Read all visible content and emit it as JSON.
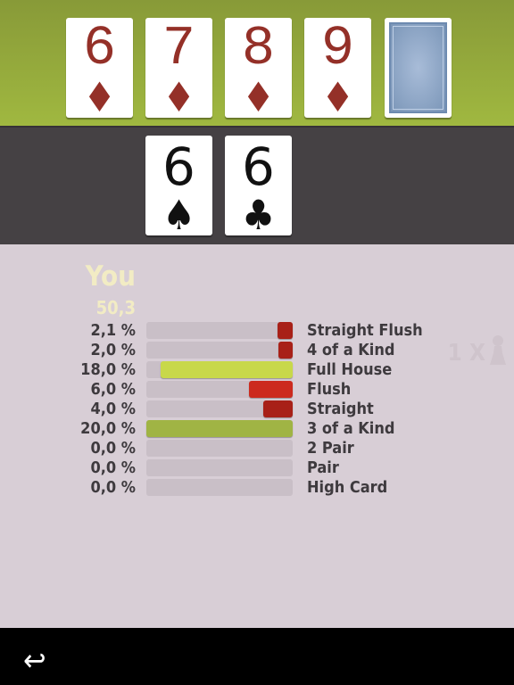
{
  "board": {
    "cards": [
      {
        "rank": "6",
        "suit": "♦"
      },
      {
        "rank": "7",
        "suit": "♦"
      },
      {
        "rank": "8",
        "suit": "♦"
      },
      {
        "rank": "9",
        "suit": "♦"
      }
    ]
  },
  "player": {
    "name": "You",
    "score": "50,3",
    "cards": [
      {
        "rank": "6",
        "suit": "♠"
      },
      {
        "rank": "6",
        "suit": "♣"
      }
    ]
  },
  "opponents": {
    "count_label": "1 X",
    "icon": "pawn-icon"
  },
  "odds": [
    {
      "pct": "2,1 %",
      "value": 2.1,
      "label": "Straight Flush",
      "color": "#a82018"
    },
    {
      "pct": "2,0 %",
      "value": 2.0,
      "label": "4 of a Kind",
      "color": "#a82018"
    },
    {
      "pct": "18,0 %",
      "value": 18.0,
      "label": "Full House",
      "color": "#c8d84a"
    },
    {
      "pct": "6,0 %",
      "value": 6.0,
      "label": "Flush",
      "color": "#cc2a1e"
    },
    {
      "pct": "4,0 %",
      "value": 4.0,
      "label": "Straight",
      "color": "#a82018"
    },
    {
      "pct": "20,0 %",
      "value": 20.0,
      "label": "3 of a Kind",
      "color": "#a0b444"
    },
    {
      "pct": "0,0 %",
      "value": 0,
      "label": "2 Pair",
      "color": "#a0b444"
    },
    {
      "pct": "0,0 %",
      "value": 0,
      "label": "Pair",
      "color": "#a0b444"
    },
    {
      "pct": "0,0 %",
      "value": 0,
      "label": "High Card",
      "color": "#a0b444"
    }
  ],
  "footer": {
    "back_icon": "↩"
  }
}
